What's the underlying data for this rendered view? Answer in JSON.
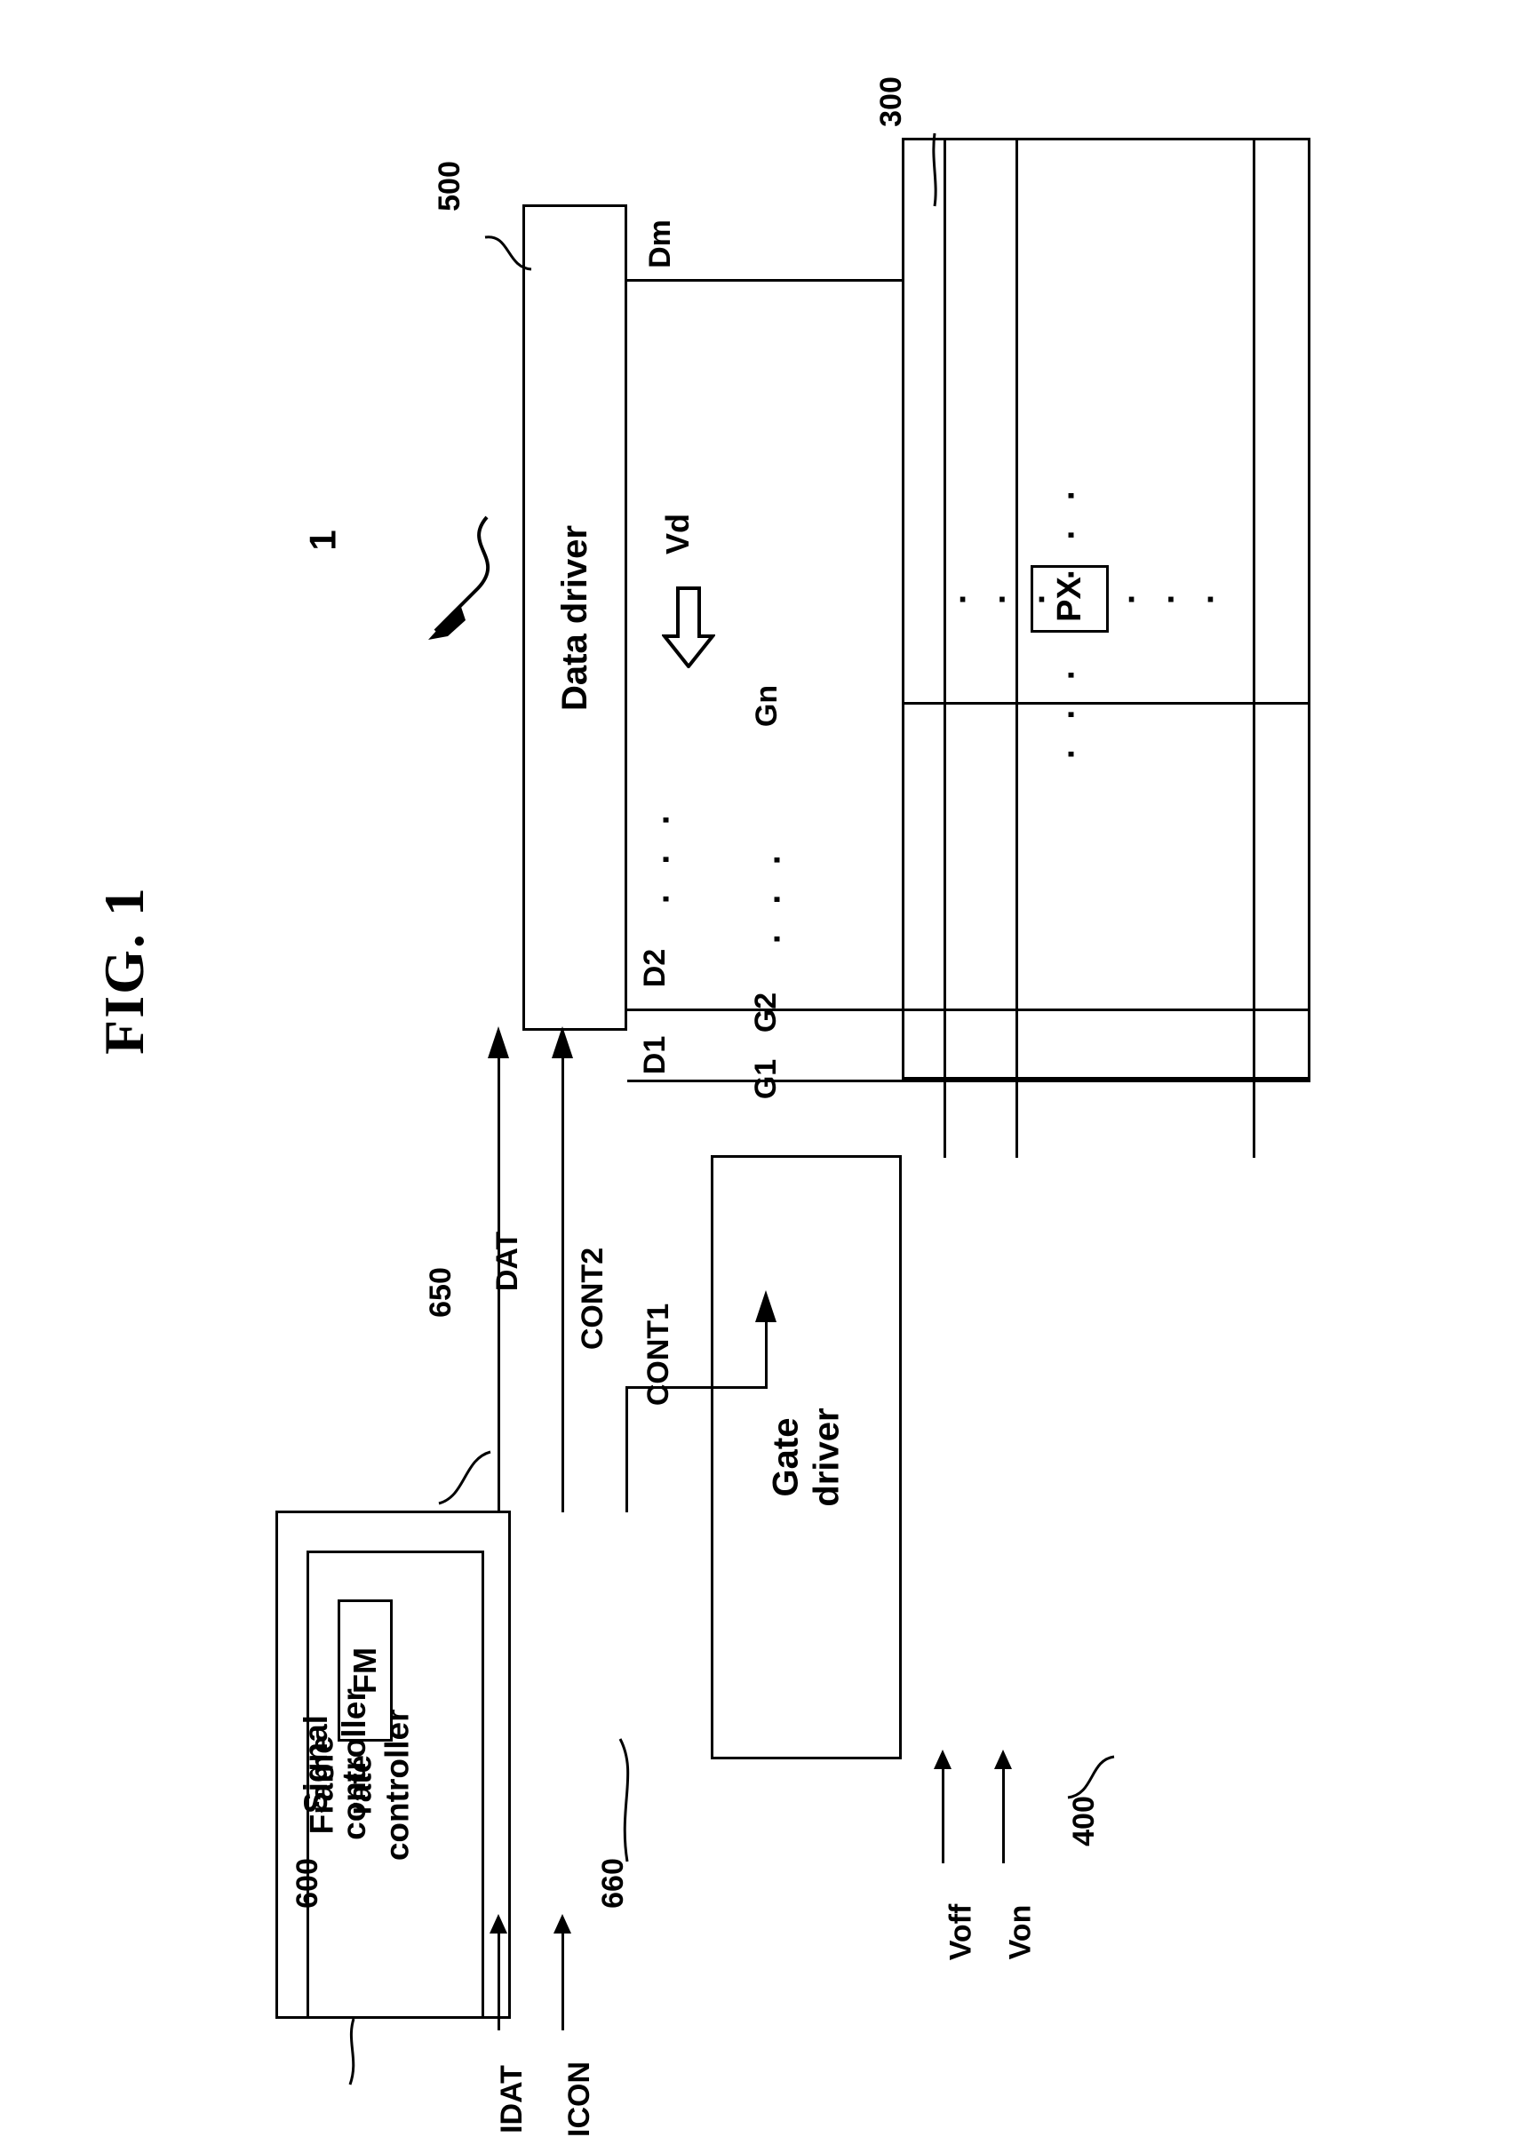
{
  "figure": {
    "title": "FIG. 1",
    "system_ref": "1"
  },
  "blocks": {
    "display_panel": {
      "ref": "300"
    },
    "gate_driver": {
      "label_line1": "Gate",
      "label_line2": "driver",
      "ref": "400"
    },
    "data_driver": {
      "label": "Data driver",
      "ref": "500"
    },
    "signal_controller": {
      "label_line1": "Signal",
      "label_line2": "controller",
      "ref": "600"
    },
    "frame_rate_controller": {
      "label_line1": "Frame",
      "label_line2": "rate",
      "label_line3": "controller",
      "ref": "650"
    },
    "frame_memory": {
      "label": "FM",
      "ref": "660"
    },
    "pixel": {
      "label": "PX"
    }
  },
  "signals": {
    "input_data": "IDAT",
    "input_control": "ICON",
    "data": "DAT",
    "control2": "CONT2",
    "control1": "CONT1",
    "gate_off_voltage": "Voff",
    "gate_on_voltage": "Von",
    "data_voltage": "Vd"
  },
  "data_lines": {
    "first": "D1",
    "second": "D2",
    "last": "Dm",
    "ellipsis": "· · ·"
  },
  "gate_lines": {
    "first": "G1",
    "second": "G2",
    "last": "Gn",
    "ellipsis": "· · ·"
  },
  "pixel_ellipsis": {
    "horizontal": "· · ·",
    "vertical": "· · ·"
  },
  "colors": {
    "ink": "#000000",
    "paper": "#ffffff"
  }
}
